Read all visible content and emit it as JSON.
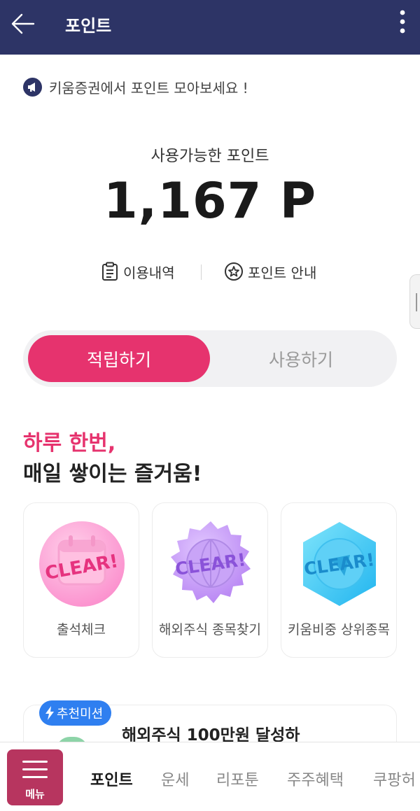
{
  "header": {
    "title": "포인트",
    "back_icon": "arrow-left-icon",
    "more_icon": "more-vertical-icon"
  },
  "notice": {
    "text": "키움증권에서 포인트 모아보세요 !",
    "icon": "megaphone-icon"
  },
  "balance": {
    "label": "사용가능한 포인트",
    "value": "1,167 P"
  },
  "links": {
    "history": "이용내역",
    "guide": "포인트 안내"
  },
  "tabs": {
    "earn": "적립하기",
    "use": "사용하기",
    "active": "earn"
  },
  "promo": {
    "line1": "하루 한번,",
    "line2": "매일 쌓이는 즐거움!"
  },
  "cards": [
    {
      "label": "출석체크",
      "badge_text": "CLEAR!",
      "icon": "calendar-badge-icon"
    },
    {
      "label": "해외주식 종목찾기",
      "badge_text": "CLEAR!",
      "icon": "globe-badge-icon"
    },
    {
      "label": "키움비중 상위종목",
      "badge_text": "CLEAR!",
      "icon": "hexagon-badge-icon"
    }
  ],
  "mission": {
    "badge": "추천미션",
    "title": "해외주식 100만원 달성하"
  },
  "bottom_nav": {
    "menu_label": "메뉴",
    "items": [
      "포인트",
      "운세",
      "리포툰",
      "주주혜택",
      "쿠팡허"
    ],
    "active": "포인트"
  },
  "colors": {
    "header": "#2d3466",
    "accent_pink": "#e6336e",
    "mission_blue": "#2f7ff0",
    "menu_button": "#b7355f"
  }
}
